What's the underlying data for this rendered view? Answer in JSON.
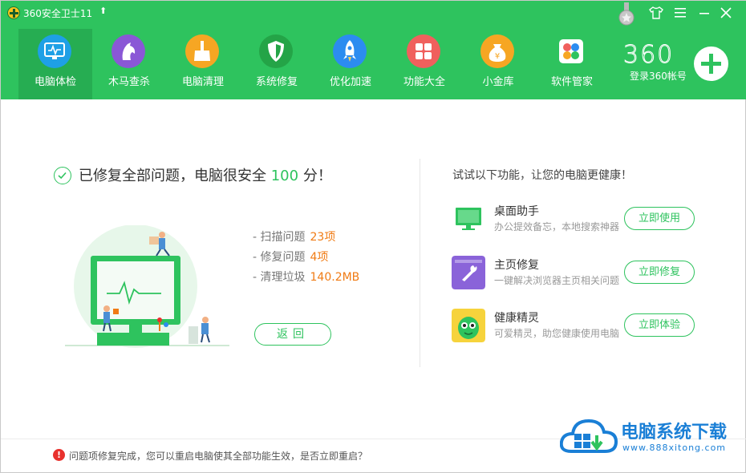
{
  "window": {
    "title": "360安全卫士11",
    "login_label": "登录360帐号",
    "brand": "360"
  },
  "nav": [
    {
      "label": "电脑体检",
      "icon": "monitor-check-icon",
      "color": "#1ea0e6",
      "active": true
    },
    {
      "label": "木马查杀",
      "icon": "horse-icon",
      "color": "#8a57d6"
    },
    {
      "label": "电脑清理",
      "icon": "broom-icon",
      "color": "#f6a623"
    },
    {
      "label": "系统修复",
      "icon": "shield-icon",
      "color": "#24a447"
    },
    {
      "label": "优化加速",
      "icon": "rocket-icon",
      "color": "#2c8cf0"
    },
    {
      "label": "功能大全",
      "icon": "grid-icon",
      "color": "#f0605d"
    },
    {
      "label": "小金库",
      "icon": "coin-bag-icon",
      "color": "#f6a623"
    },
    {
      "label": "软件管家",
      "icon": "software-icon",
      "color": "#ffffff"
    }
  ],
  "result": {
    "prefix": "已修复全部问题，电脑很安全",
    "score": "100",
    "suffix": "分！"
  },
  "stats": [
    {
      "label": "- 扫描问题",
      "value": "23项"
    },
    {
      "label": "- 修复问题",
      "value": "4项"
    },
    {
      "label": "- 清理垃圾",
      "value": "140.2MB"
    }
  ],
  "back_button": "返回",
  "side_title": "试试以下功能，让您的电脑更健康！",
  "features": [
    {
      "name": "桌面助手",
      "desc": "办公提效备忘，本地搜索神器",
      "button": "立即使用",
      "icon": "desktop-assistant-icon",
      "color": "#2ec35e"
    },
    {
      "name": "主页修复",
      "desc": "一键解决浏览器主页相关问题",
      "button": "立即修复",
      "icon": "wrench-icon",
      "color": "#8a63d9"
    },
    {
      "name": "健康精灵",
      "desc": "可爱精灵，助您健康使用电脑",
      "button": "立即体验",
      "icon": "health-sprite-icon",
      "color": "#f6d33c"
    }
  ],
  "status": {
    "text": "问题项修复完成，您可以重启电脑使其全部功能生效，是否立即重启？"
  },
  "watermark": {
    "title": "电脑系统下载",
    "url": "www.888xitong.com"
  }
}
